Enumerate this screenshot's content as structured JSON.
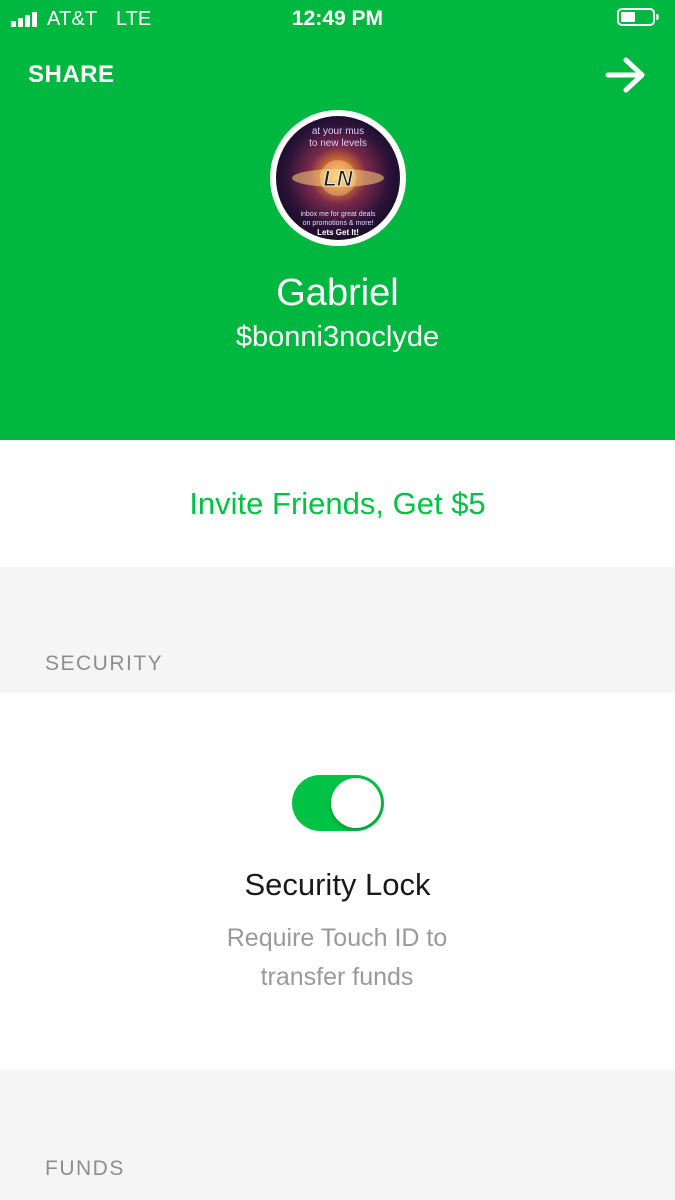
{
  "status_bar": {
    "carrier": "AT&T",
    "network": "LTE",
    "time": "12:49 PM",
    "signal_bars": 4,
    "battery_level": 0.45
  },
  "header": {
    "share_label": "SHARE",
    "forward_icon": "arrow-right-icon",
    "background_color": "#00b83f"
  },
  "profile": {
    "name": "Gabriel",
    "cashtag": "$bonni3noclyde",
    "avatar_text": {
      "top": "at your mus",
      "top2": "to new levels",
      "logo": "LN",
      "bottom1": "inbox me for great deals",
      "bottom2": "on promotions & more!",
      "bottom3": "Lets Get It!"
    }
  },
  "invite": {
    "label": "Invite Friends, Get $5",
    "color": "#00c244"
  },
  "sections": {
    "security": {
      "header": "SECURITY",
      "security_lock": {
        "title": "Security Lock",
        "description_line1": "Require Touch ID to",
        "description_line2": "transfer funds",
        "enabled": true,
        "toggle_color": "#00c244"
      }
    },
    "funds": {
      "header": "FUNDS"
    }
  }
}
